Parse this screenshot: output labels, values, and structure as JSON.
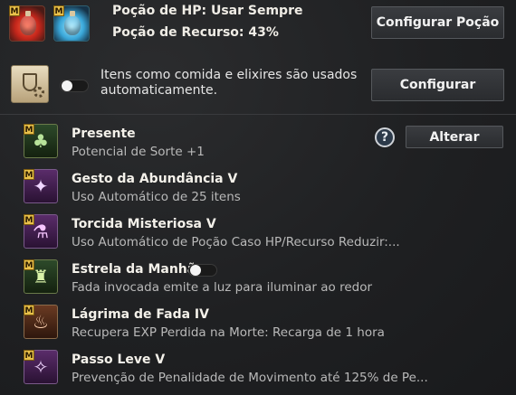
{
  "potion": {
    "hp_label": "Poção de HP: Usar Sempre",
    "resource_label": "Poção de Recurso: 43%",
    "resource_percent": 43,
    "configure_button": "Configurar Poção"
  },
  "auto_items": {
    "description": "Itens como comida e elixires são usados automaticamente.",
    "toggle_on": false,
    "configure_button": "Configurar"
  },
  "blessings": [
    {
      "badge": "M",
      "title": "Presente",
      "subtitle": "Potencial de Sorte +1",
      "icon": "clover-icon"
    },
    {
      "badge": "M",
      "title": "Gesto da Abundância V",
      "subtitle": "Uso Automático de 25 itens",
      "icon": "fairy-icon"
    },
    {
      "badge": "M",
      "title": "Torcida Misteriosa V",
      "subtitle": "Uso Automático de Poção Caso HP/Recurso Reduzir:...",
      "icon": "potion-cheer-icon"
    },
    {
      "badge": "M",
      "title": "Estrela da Manhã",
      "subtitle": "Fada invocada emite a luz para iluminar ao redor",
      "icon": "lantern-icon",
      "toggle_on": false
    },
    {
      "badge": "M",
      "title": "Lágrima de Fada IV",
      "subtitle": "Recupera EXP Perdida na Morte: Recarga de 1 hora",
      "icon": "fairy-tear-icon"
    },
    {
      "badge": "M",
      "title": "Passo Leve V",
      "subtitle": "Prevenção de Penalidade de Movimento até 125% de Pe...",
      "icon": "light-step-icon"
    }
  ],
  "help_symbol": "?",
  "change_button": "Alterar"
}
